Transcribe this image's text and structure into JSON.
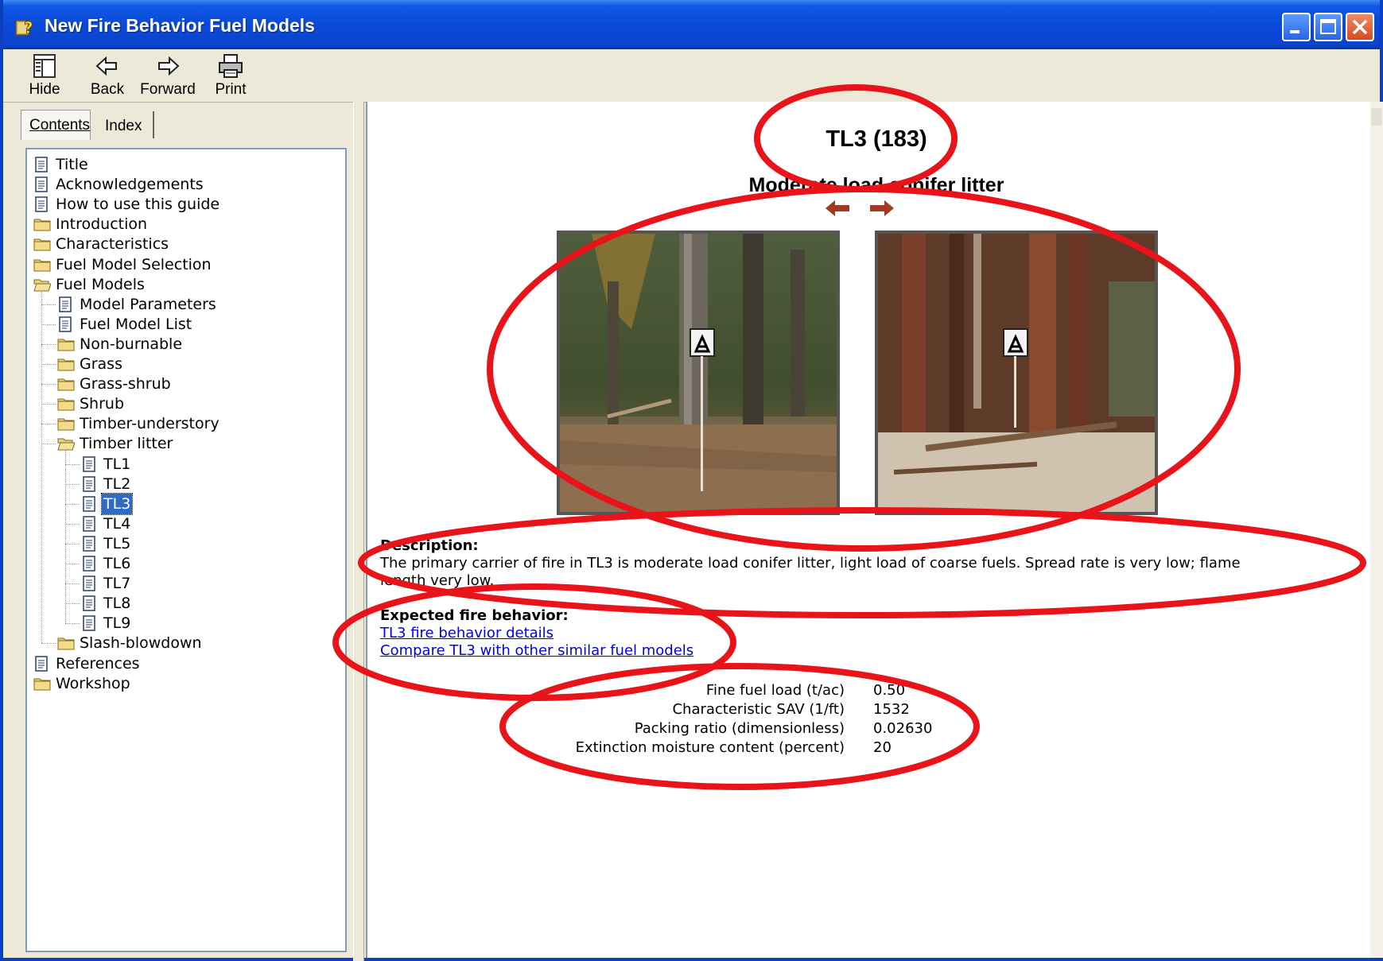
{
  "window": {
    "title": "New Fire Behavior Fuel Models",
    "controls": [
      "minimize-icon",
      "maximize-icon",
      "close-icon"
    ]
  },
  "toolbar": {
    "hide_label": "Hide",
    "back_label": "Back",
    "forward_label": "Forward",
    "print_label": "Print"
  },
  "tabs": {
    "contents": "Contents",
    "index": "Index"
  },
  "tree": {
    "items": [
      {
        "label": "Title",
        "type": "page",
        "indent": 0
      },
      {
        "label": "Acknowledgements",
        "type": "page",
        "indent": 0
      },
      {
        "label": "How to use this guide",
        "type": "page",
        "indent": 0
      },
      {
        "label": "Introduction",
        "type": "folder",
        "indent": 0
      },
      {
        "label": "Characteristics",
        "type": "folder",
        "indent": 0
      },
      {
        "label": "Fuel Model Selection",
        "type": "folder",
        "indent": 0
      },
      {
        "label": "Fuel Models",
        "type": "folder-open",
        "indent": 0
      },
      {
        "label": "Model Parameters",
        "type": "page",
        "indent": 1
      },
      {
        "label": "Fuel Model List",
        "type": "page",
        "indent": 1
      },
      {
        "label": "Non-burnable",
        "type": "folder",
        "indent": 1
      },
      {
        "label": "Grass",
        "type": "folder",
        "indent": 1
      },
      {
        "label": "Grass-shrub",
        "type": "folder",
        "indent": 1
      },
      {
        "label": "Shrub",
        "type": "folder",
        "indent": 1
      },
      {
        "label": "Timber-understory",
        "type": "folder",
        "indent": 1
      },
      {
        "label": "Timber litter",
        "type": "folder-open",
        "indent": 1
      },
      {
        "label": "TL1",
        "type": "page",
        "indent": 2
      },
      {
        "label": "TL2",
        "type": "page",
        "indent": 2
      },
      {
        "label": "TL3",
        "type": "page",
        "indent": 2,
        "selected": true
      },
      {
        "label": "TL4",
        "type": "page",
        "indent": 2
      },
      {
        "label": "TL5",
        "type": "page",
        "indent": 2
      },
      {
        "label": "TL6",
        "type": "page",
        "indent": 2
      },
      {
        "label": "TL7",
        "type": "page",
        "indent": 2
      },
      {
        "label": "TL8",
        "type": "page",
        "indent": 2
      },
      {
        "label": "TL9",
        "type": "page",
        "indent": 2
      },
      {
        "label": "Slash-blowdown",
        "type": "folder",
        "indent": 1
      },
      {
        "label": "References",
        "type": "page",
        "indent": 0
      },
      {
        "label": "Workshop",
        "type": "folder",
        "indent": 0
      }
    ]
  },
  "content": {
    "title": "TL3 (183)",
    "subtitle": "Moderate load conifer litter",
    "description_heading": "Description:",
    "description_line1": "The primary carrier of fire in TL3 is moderate load conifer litter, light load of coarse fuels. Spread rate is very low; flame",
    "description_line2": "length very low.",
    "behavior_heading": "Expected fire behavior:",
    "link1": "TL3 fire behavior details",
    "link2": "Compare TL3 with other similar fuel models",
    "params": [
      {
        "name": "Fine fuel load (t/ac)",
        "value": "0.50"
      },
      {
        "name": "Characteristic SAV (1/ft)",
        "value": "1532"
      },
      {
        "name": "Packing ratio (dimensionless)",
        "value": "0.02630"
      },
      {
        "name": "Extinction moisture content (percent)",
        "value": "20"
      }
    ]
  },
  "colors": {
    "titlebar": "#0a4ad8",
    "selection": "#316ac5",
    "link": "#0000ee",
    "annotation": "#e8141a"
  }
}
